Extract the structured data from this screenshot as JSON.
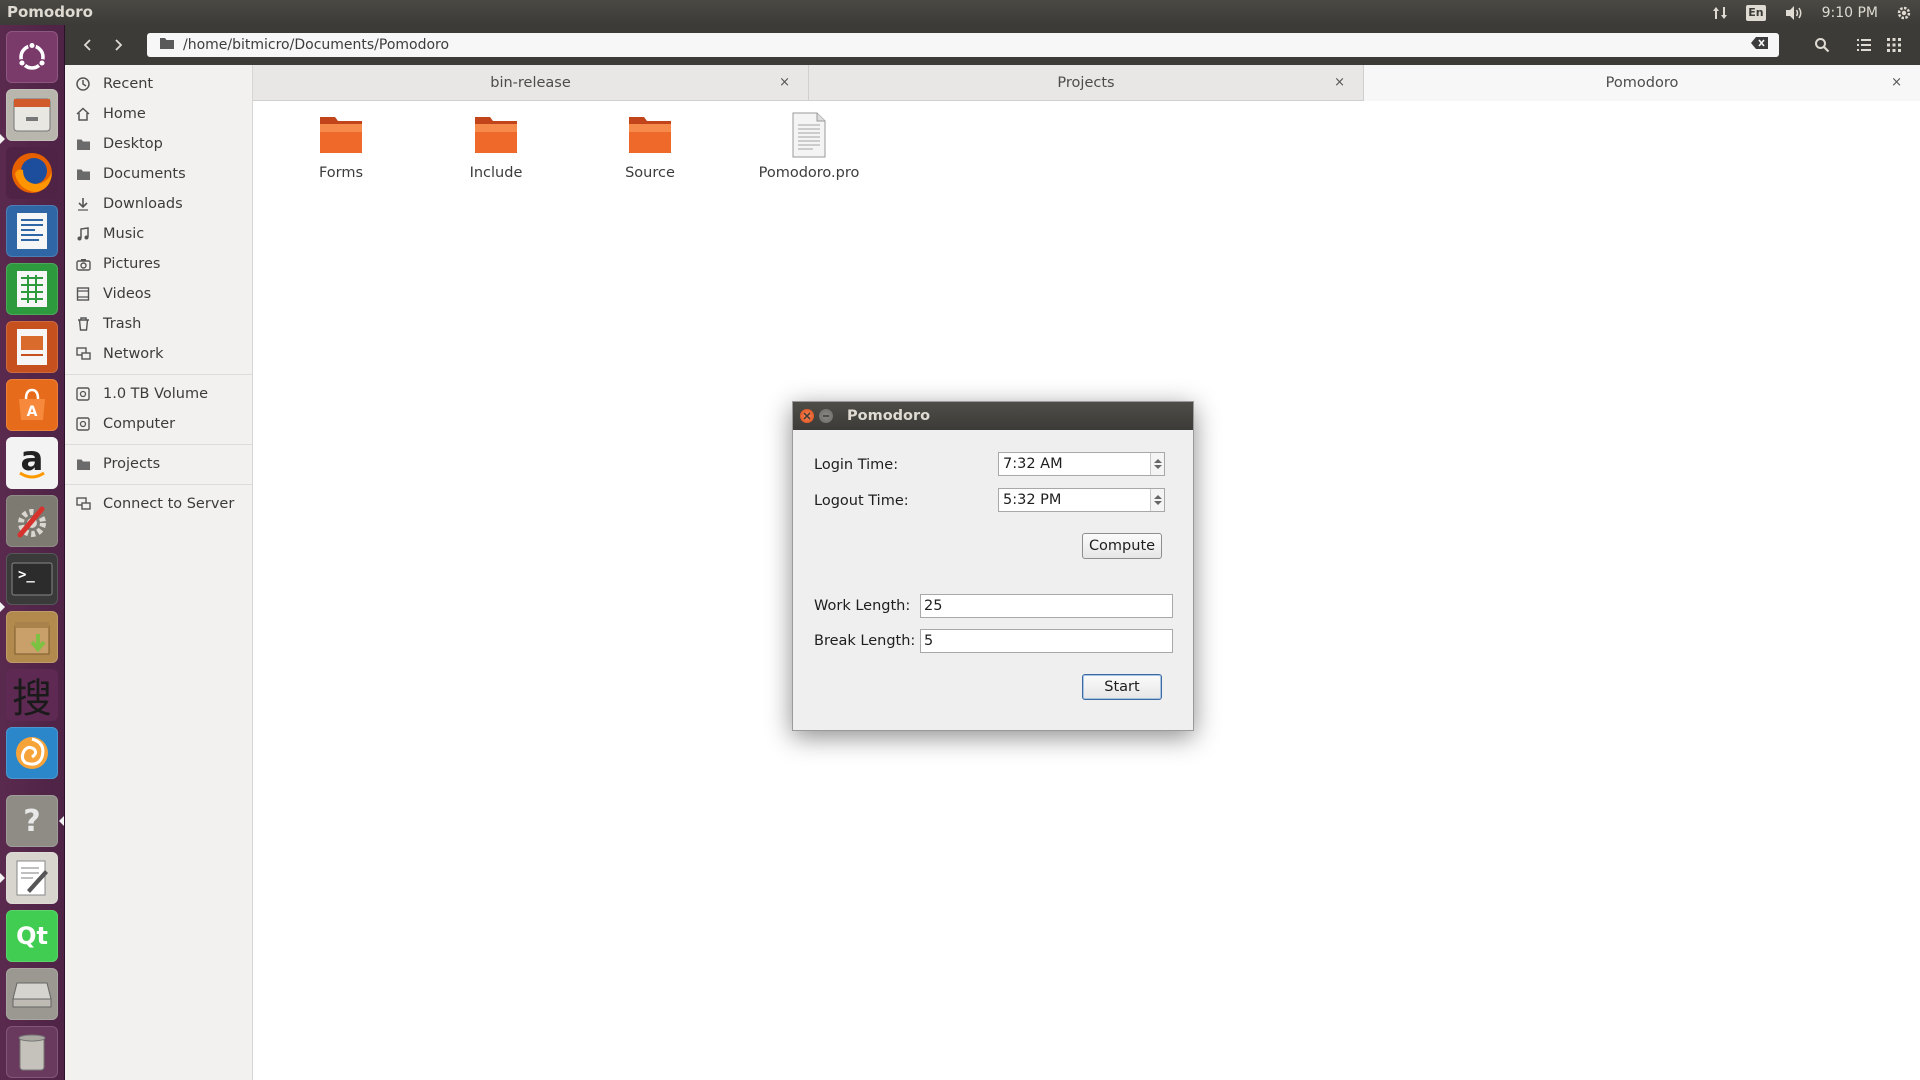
{
  "top_panel": {
    "app_title": "Pomodoro",
    "keyboard_indicator": "En",
    "clock": "9:10 PM"
  },
  "launcher": {
    "items": [
      {
        "name": "ubuntu-dash-icon"
      },
      {
        "name": "files-icon"
      },
      {
        "name": "firefox-icon"
      },
      {
        "name": "libreoffice-writer-icon"
      },
      {
        "name": "libreoffice-calc-icon"
      },
      {
        "name": "libreoffice-impress-icon"
      },
      {
        "name": "ubuntu-software-icon"
      },
      {
        "name": "amazon-icon"
      },
      {
        "name": "system-settings-icon"
      },
      {
        "name": "terminal-icon"
      },
      {
        "name": "archive-manager-icon"
      },
      {
        "name": "sogou-input-icon"
      },
      {
        "name": "shotwell-icon"
      },
      {
        "name": "help-icon"
      },
      {
        "name": "text-editor-icon"
      },
      {
        "name": "qt-creator-icon"
      },
      {
        "name": "drive-icon"
      },
      {
        "name": "trash-icon"
      }
    ],
    "amazon_glyph": "a",
    "sogou_glyph": "搜",
    "help_glyph": "?",
    "qt_glyph": "Qt",
    "terminal_glyph": ">_"
  },
  "toolbar": {
    "path": "/home/bitmicro/Documents/Pomodoro"
  },
  "sidebar": {
    "items": [
      {
        "label": "Recent",
        "icon": "clock-icon"
      },
      {
        "label": "Home",
        "icon": "home-icon"
      },
      {
        "label": "Desktop",
        "icon": "folder-icon"
      },
      {
        "label": "Documents",
        "icon": "folder-icon"
      },
      {
        "label": "Downloads",
        "icon": "download-icon"
      },
      {
        "label": "Music",
        "icon": "music-icon"
      },
      {
        "label": "Pictures",
        "icon": "camera-icon"
      },
      {
        "label": "Videos",
        "icon": "film-icon"
      },
      {
        "label": "Trash",
        "icon": "trash-icon"
      },
      {
        "label": "Network",
        "icon": "network-icon"
      },
      {
        "label": "1.0 TB Volume",
        "icon": "drive-icon"
      },
      {
        "label": "Computer",
        "icon": "drive-icon"
      },
      {
        "label": "Projects",
        "icon": "folder-icon"
      },
      {
        "label": "Connect to Server",
        "icon": "network-icon"
      }
    ]
  },
  "tabs": [
    {
      "label": "bin-release",
      "close": "×"
    },
    {
      "label": "Projects",
      "close": "×"
    },
    {
      "label": "Pomodoro",
      "close": "×"
    }
  ],
  "files": [
    {
      "name": "Forms",
      "type": "folder"
    },
    {
      "name": "Include",
      "type": "folder"
    },
    {
      "name": "Source",
      "type": "folder"
    },
    {
      "name": "Pomodoro.pro",
      "type": "document"
    }
  ],
  "dialog": {
    "title": "Pomodoro",
    "login_label": "Login Time:",
    "login_value": "7:32 AM",
    "logout_label": "Logout Time:",
    "logout_value": "5:32 PM",
    "compute_label": "Compute",
    "work_label": "Work Length:",
    "work_value": "25",
    "break_label": "Break Length:",
    "break_value": "5",
    "start_label": "Start"
  },
  "colors": {
    "panel": "#3c3b37",
    "launcher": "#5a2a4e",
    "folder_orange": "#e5571f",
    "close_orange": "#dd4814"
  }
}
